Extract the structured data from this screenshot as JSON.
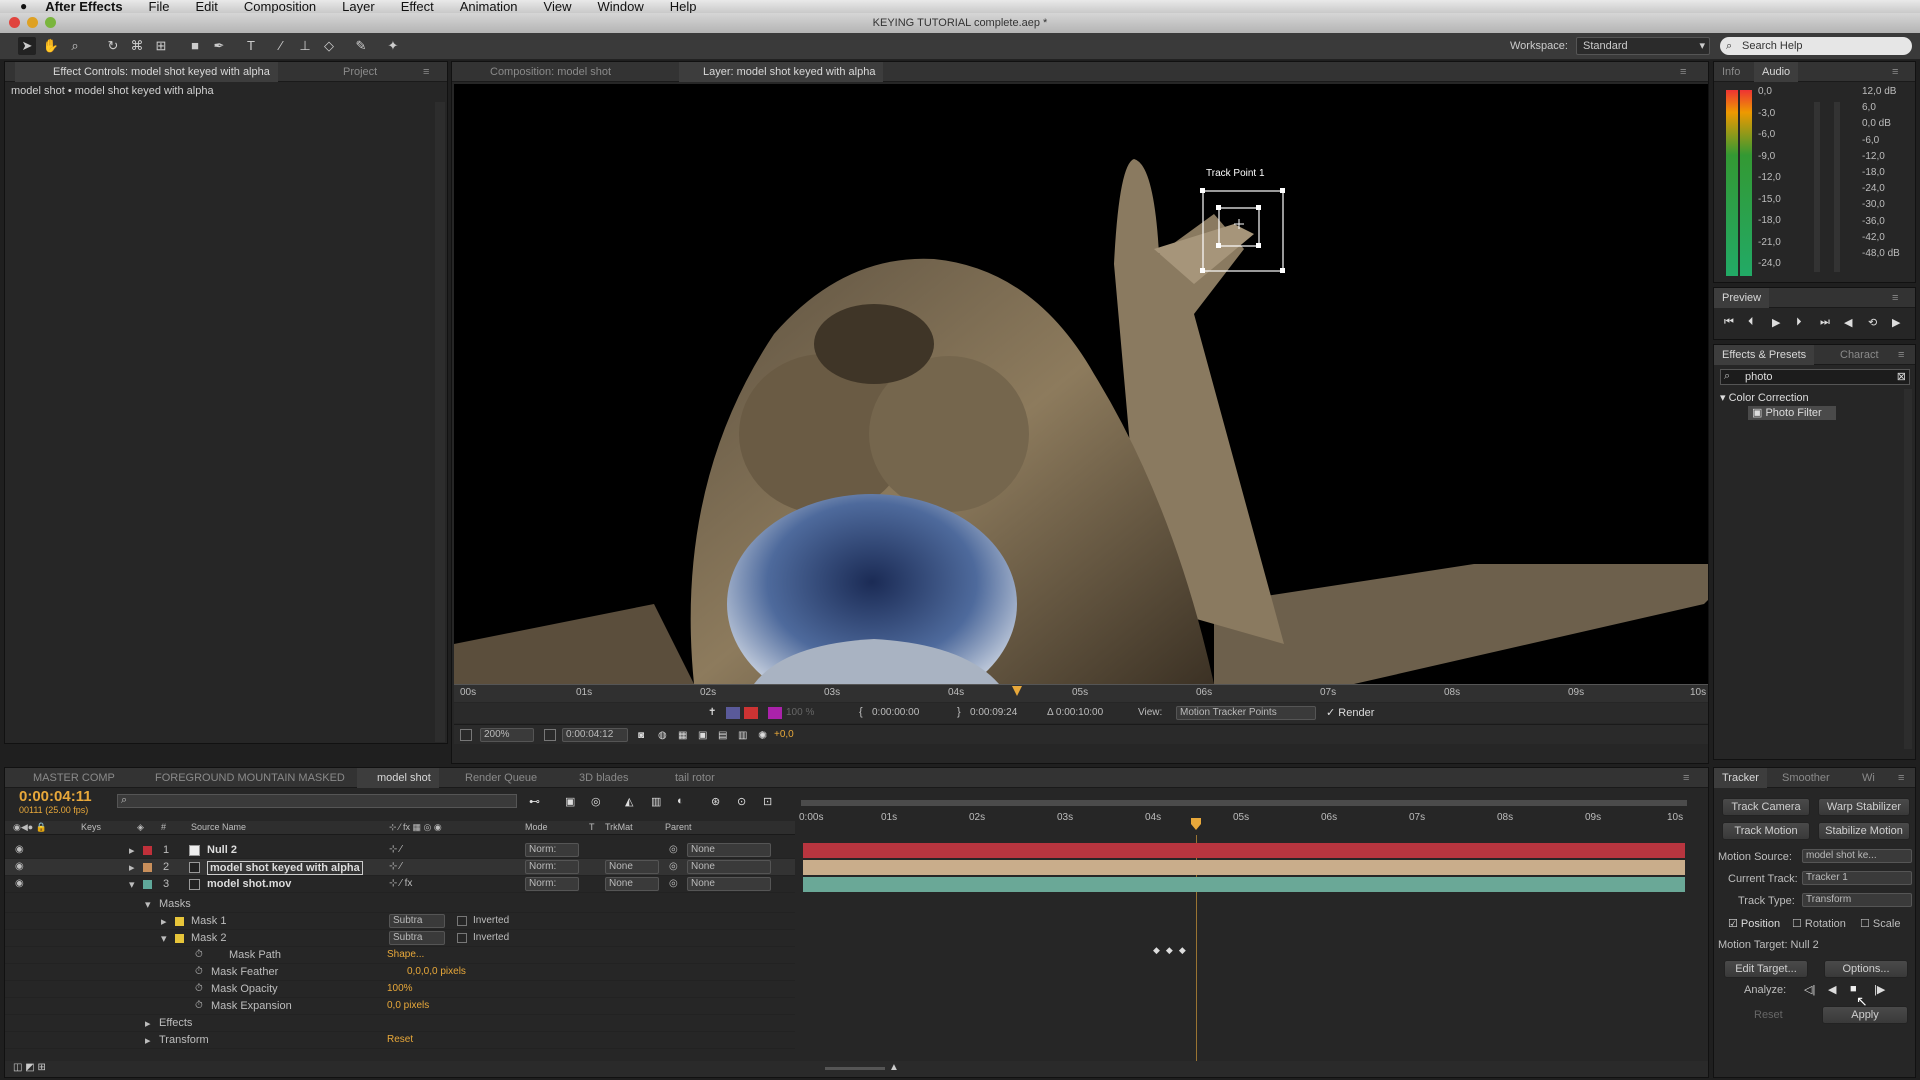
{
  "menubar": {
    "app_name": "After Effects",
    "items": [
      "File",
      "Edit",
      "Composition",
      "Layer",
      "Effect",
      "Animation",
      "View",
      "Window",
      "Help"
    ]
  },
  "window": {
    "title": "KEYING TUTORIAL complete.aep *"
  },
  "toolbar": {
    "workspace_label": "Workspace:",
    "workspace_value": "Standard",
    "search_help_placeholder": "Search Help"
  },
  "effect_controls": {
    "tab_label": "Effect Controls: model shot keyed with alpha",
    "project_tab": "Project",
    "breadcrumb": "model shot • model shot keyed with alpha"
  },
  "viewer": {
    "composition_tab": "Composition: model shot",
    "layer_tab": "Layer: model shot keyed with alpha",
    "track_point_label": "Track Point 1",
    "ruler_ticks": [
      "00s",
      "01s",
      "02s",
      "03s",
      "04s",
      "05s",
      "06s",
      "07s",
      "08s",
      "09s",
      "10s"
    ],
    "current_in": "0:00:00:00",
    "current_out": "0:00:09:24",
    "duration": "Δ 0:00:10:00",
    "view_label": "View:",
    "view_value": "Motion Tracker Points",
    "render_label": "Render",
    "zoom": "200%",
    "timecode": "0:00:04:12",
    "exposure": "+0,0",
    "res": "100 %"
  },
  "info_panel": {
    "tabs": [
      "Info",
      "Audio"
    ],
    "db_left": [
      "0,0",
      "-3,0",
      "-6,0",
      "-9,0",
      "-12,0",
      "-15,0",
      "-18,0",
      "-21,0",
      "-24,0"
    ],
    "db_right": [
      "12,0 dB",
      "6,0",
      "0,0 dB",
      "-6,0",
      "-12,0",
      "-18,0",
      "-24,0",
      "-30,0",
      "-36,0",
      "-42,0",
      "-48,0 dB"
    ],
    "meter_zero_left": "0",
    "meter_zero_right": "0"
  },
  "preview_panel": {
    "tab": "Preview"
  },
  "effects_presets": {
    "tabs": [
      "Effects & Presets",
      "Charact"
    ],
    "search_value": "photo",
    "category": "Color Correction",
    "item": "Photo Filter"
  },
  "timeline": {
    "tabs": [
      "MASTER COMP",
      "FOREGROUND MOUNTAIN MASKED",
      "model shot",
      "Render Queue",
      "3D blades",
      "tail rotor"
    ],
    "current_time": "0:00:04:11",
    "frame_info": "00111 (25.00 fps)",
    "search_placeholder": "",
    "ruler_ticks": [
      "0:00s",
      "01s",
      "02s",
      "03s",
      "04s",
      "05s",
      "06s",
      "07s",
      "08s",
      "09s",
      "10s"
    ],
    "col_headers": {
      "keys": "Keys",
      "num": "#",
      "source": "Source Name",
      "mode": "Mode",
      "t": "T",
      "trkmat": "TrkMat",
      "parent": "Parent"
    },
    "layers": [
      {
        "num": "1",
        "name": "Null 2",
        "mode": "Norm:",
        "trkmat": "",
        "parent": "None",
        "color": "#c0303a",
        "bar": "#b8353f"
      },
      {
        "num": "2",
        "name": "model shot keyed with alpha",
        "mode": "Norm:",
        "trkmat": "None",
        "parent": "None",
        "color": "#c98f5b",
        "bar": "#c9ad8b"
      },
      {
        "num": "3",
        "name": "model shot.mov",
        "mode": "Norm:",
        "trkmat": "None",
        "parent": "None",
        "color": "#5fa89a",
        "bar": "#6aa897"
      }
    ],
    "masks_group": "Masks",
    "mask1": {
      "name": "Mask 1",
      "mode": "Subtra",
      "inverted": "Inverted"
    },
    "mask2": {
      "name": "Mask 2",
      "mode": "Subtra",
      "inverted": "Inverted"
    },
    "mask_props": [
      {
        "name": "Mask Path",
        "value": "Shape..."
      },
      {
        "name": "Mask Feather",
        "value": "0,0,0,0 pixels"
      },
      {
        "name": "Mask Opacity",
        "value": "100%"
      },
      {
        "name": "Mask Expansion",
        "value": "0,0 pixels"
      }
    ],
    "effects_group": "Effects",
    "transform_group": "Transform",
    "transform_reset": "Reset"
  },
  "tracker": {
    "tabs": [
      "Tracker",
      "Smoother",
      "Wi"
    ],
    "track_camera": "Track Camera",
    "warp_stabilizer": "Warp Stabilizer",
    "track_motion": "Track Motion",
    "stabilize_motion": "Stabilize Motion",
    "motion_source_label": "Motion Source:",
    "motion_source_value": "model shot ke...",
    "current_track_label": "Current Track:",
    "current_track_value": "Tracker 1",
    "track_type_label": "Track Type:",
    "track_type_value": "Transform",
    "position": "Position",
    "rotation": "Rotation",
    "scale": "Scale",
    "motion_target": "Motion Target: Null 2",
    "edit_target": "Edit Target...",
    "options": "Options...",
    "analyze_label": "Analyze:",
    "reset": "Reset",
    "apply": "Apply"
  },
  "colors": {
    "accent_orange": "#e8a83a",
    "null_layer": "#c0303a",
    "keyed_layer": "#c9ad8b",
    "mov_layer": "#6aa897"
  }
}
